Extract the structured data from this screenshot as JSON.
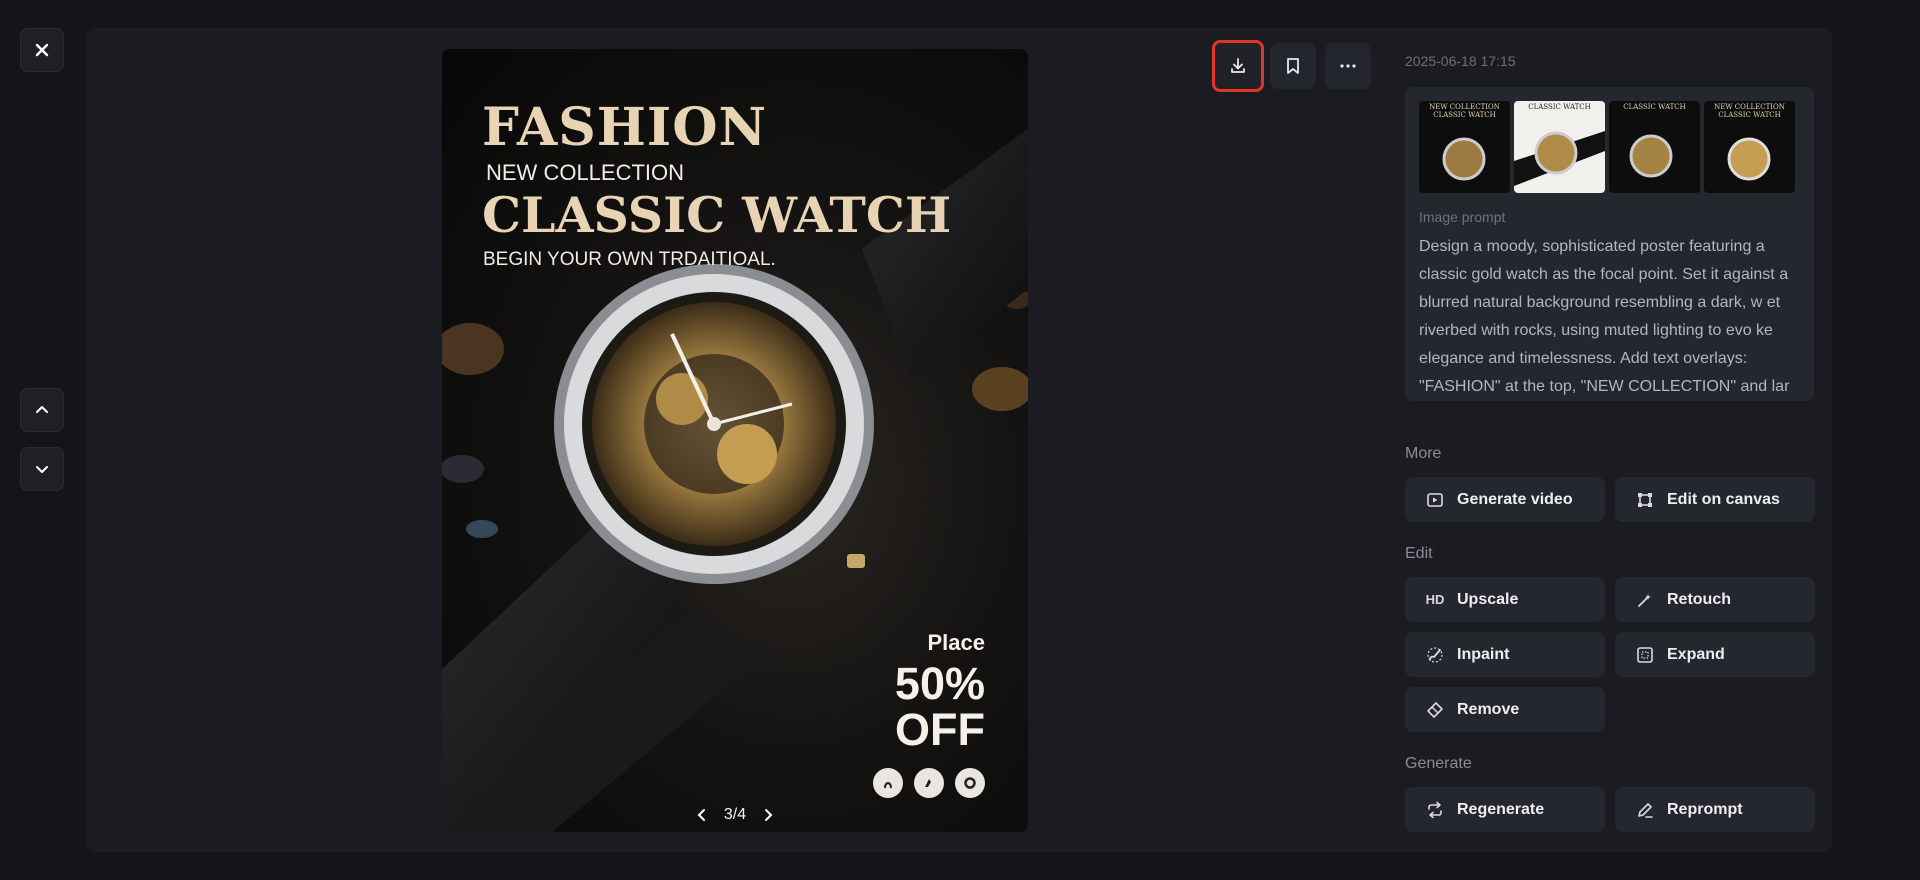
{
  "viewer": {
    "pager": {
      "current": "3/4"
    }
  },
  "poster": {
    "title": "FASHION",
    "subtitle": "NEW COLLECTION",
    "headline": "CLASSIC WATCH",
    "tagline": "BEGIN YOUR OWN TRDAITIOAL.",
    "promo_place": "Place",
    "promo_percent": "50%",
    "promo_off": "OFF"
  },
  "thumbnails": [
    {
      "text": "NEW COLLECTION CLASSIC WATCH",
      "theme": "dark"
    },
    {
      "text": "CLASSIC WATCH",
      "theme": "light"
    },
    {
      "text": "CLASSIC WATCH",
      "theme": "dark"
    },
    {
      "text": "NEW COLLECTION CLASSIC WATCH",
      "theme": "dark"
    }
  ],
  "details": {
    "timestamp": "2025-06-18 17:15",
    "prompt_label": "Image prompt",
    "prompt_text": "Design a moody, sophisticated poster featuring a classic gold watch as the focal point. Set it against a blurred natural background resembling a dark, w et riverbed with rocks, using muted lighting to evo ke elegance and timelessness. Add text overlays: \"FASHION\" at the top, \"NEW COLLECTION\" and lar"
  },
  "sections": {
    "more": {
      "label": "More",
      "generate_video": "Generate video",
      "edit_on_canvas": "Edit on canvas"
    },
    "edit": {
      "label": "Edit",
      "upscale_badge": "HD",
      "upscale": "Upscale",
      "retouch": "Retouch",
      "inpaint": "Inpaint",
      "expand": "Expand",
      "remove": "Remove"
    },
    "generate": {
      "label": "Generate",
      "regenerate": "Regenerate",
      "reprompt": "Reprompt"
    }
  },
  "colors": {
    "background": "#141519",
    "panel": "#1b1c22",
    "button": "#25272e",
    "highlight": "#e0352b",
    "poster_gold": "#e8d3b4"
  }
}
